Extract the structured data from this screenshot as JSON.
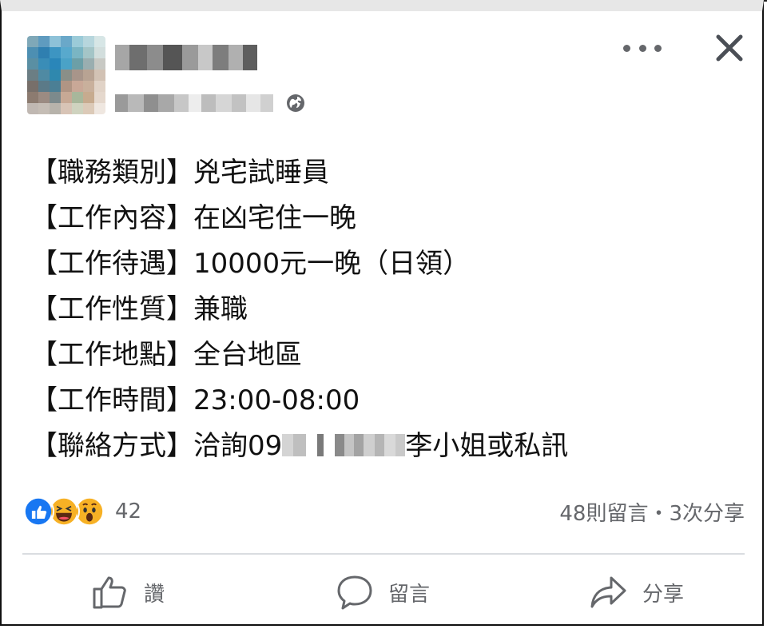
{
  "post": {
    "fields": [
      {
        "label": "【職務類別】",
        "value": "兇宅試睡員"
      },
      {
        "label": "【工作內容】",
        "value": "在凶宅住一晚"
      },
      {
        "label": "【工作待遇】",
        "value": "10000元一晚（日領）"
      },
      {
        "label": "【工作性質】",
        "value": "兼職"
      },
      {
        "label": "【工作地點】",
        "value": "全台地區"
      },
      {
        "label": "【工作時間】",
        "value": "23:00-08:00"
      }
    ],
    "contact": {
      "label": "【聯絡方式】",
      "prefix": "洽詢09",
      "suffix": "李小姐或私訊"
    }
  },
  "footer": {
    "reaction_count": "42",
    "stats": "48則留言・3次分享",
    "like_label": "讚",
    "comment_label": "留言",
    "share_label": "分享"
  },
  "icons": {
    "more": "more-options-icon",
    "close": "close-icon",
    "privacy": "globe-icon",
    "like": "thumbs-up-icon",
    "comment": "comment-bubble-icon",
    "share": "share-arrow-icon"
  },
  "colors": {
    "like_blue": "#1877f2",
    "haha_yellow": "#f7b125",
    "secondary_text": "#65676b"
  }
}
